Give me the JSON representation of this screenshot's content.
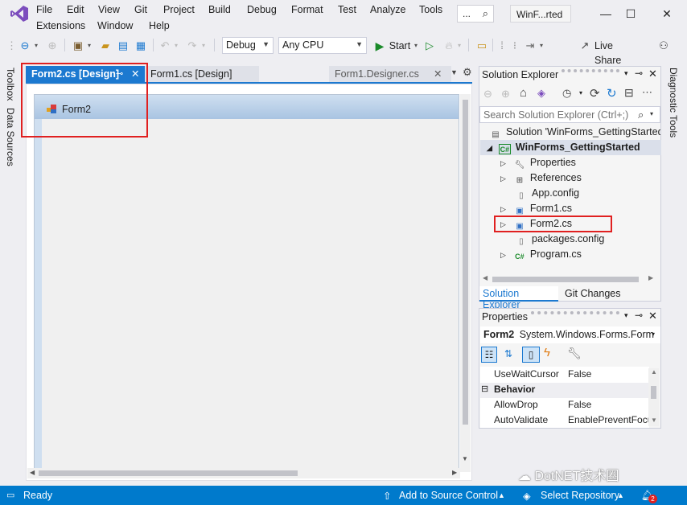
{
  "menu": {
    "row1": [
      "File",
      "Edit",
      "View",
      "Git",
      "Project",
      "Build",
      "Debug",
      "Format",
      "Test",
      "Analyze",
      "Tools"
    ],
    "row2": [
      "Extensions",
      "Window",
      "Help"
    ]
  },
  "search": {
    "text": "...",
    "icon": "search-icon"
  },
  "window": {
    "title": "WinF...rted",
    "minimize": "—",
    "maximize": "☐",
    "close": "✕"
  },
  "toolbar": {
    "config": "Debug",
    "platform": "Any CPU",
    "start_label": "Start",
    "live_share": "Live Share"
  },
  "left_strip": {
    "toolbox": "Toolbox",
    "data_sources": "Data Sources"
  },
  "right_strip": {
    "diagnostic": "Diagnostic Tools"
  },
  "tabs": [
    {
      "label": "Form2.cs [Design]",
      "active": true
    },
    {
      "label": "Form1.cs [Design]",
      "active": false
    },
    {
      "label": "Form1.Designer.cs",
      "active": false
    }
  ],
  "designer": {
    "form_title": "Form2"
  },
  "solution_explorer": {
    "title": "Solution Explorer",
    "search_placeholder": "Search Solution Explorer (Ctrl+;)",
    "solution": "Solution 'WinForms_GettingStarted'",
    "project": "WinForms_GettingStarted",
    "items": [
      {
        "label": "Properties",
        "icon": "wrench-icon",
        "expandable": true
      },
      {
        "label": "References",
        "icon": "references-icon",
        "expandable": true
      },
      {
        "label": "App.config",
        "icon": "config-file-icon",
        "expandable": false
      },
      {
        "label": "Form1.cs",
        "icon": "form-icon",
        "expandable": true
      },
      {
        "label": "Form2.cs",
        "icon": "form-icon",
        "expandable": true
      },
      {
        "label": "packages.config",
        "icon": "config-file-icon",
        "expandable": false
      },
      {
        "label": "Program.cs",
        "icon": "csharp-file-icon",
        "expandable": true
      }
    ],
    "bottom_tabs": [
      "Solution Explorer",
      "Git Changes"
    ]
  },
  "properties": {
    "title": "Properties",
    "object_name": "Form2",
    "object_type": "System.Windows.Forms.Form",
    "rows": [
      {
        "name": "UseWaitCursor",
        "value": "False"
      },
      {
        "category": "Behavior"
      },
      {
        "name": "AllowDrop",
        "value": "False"
      },
      {
        "name": "AutoValidate",
        "value": "EnablePreventFocu"
      }
    ]
  },
  "status": {
    "ready": "Ready",
    "source_control": "Add to Source Control",
    "repository": "Select Repository",
    "notifications": "2"
  },
  "watermark": "DotNET技术圈",
  "colors": {
    "accent": "#007acc",
    "tab_active": "#1c79d0",
    "highlight_box": "#e02020"
  }
}
